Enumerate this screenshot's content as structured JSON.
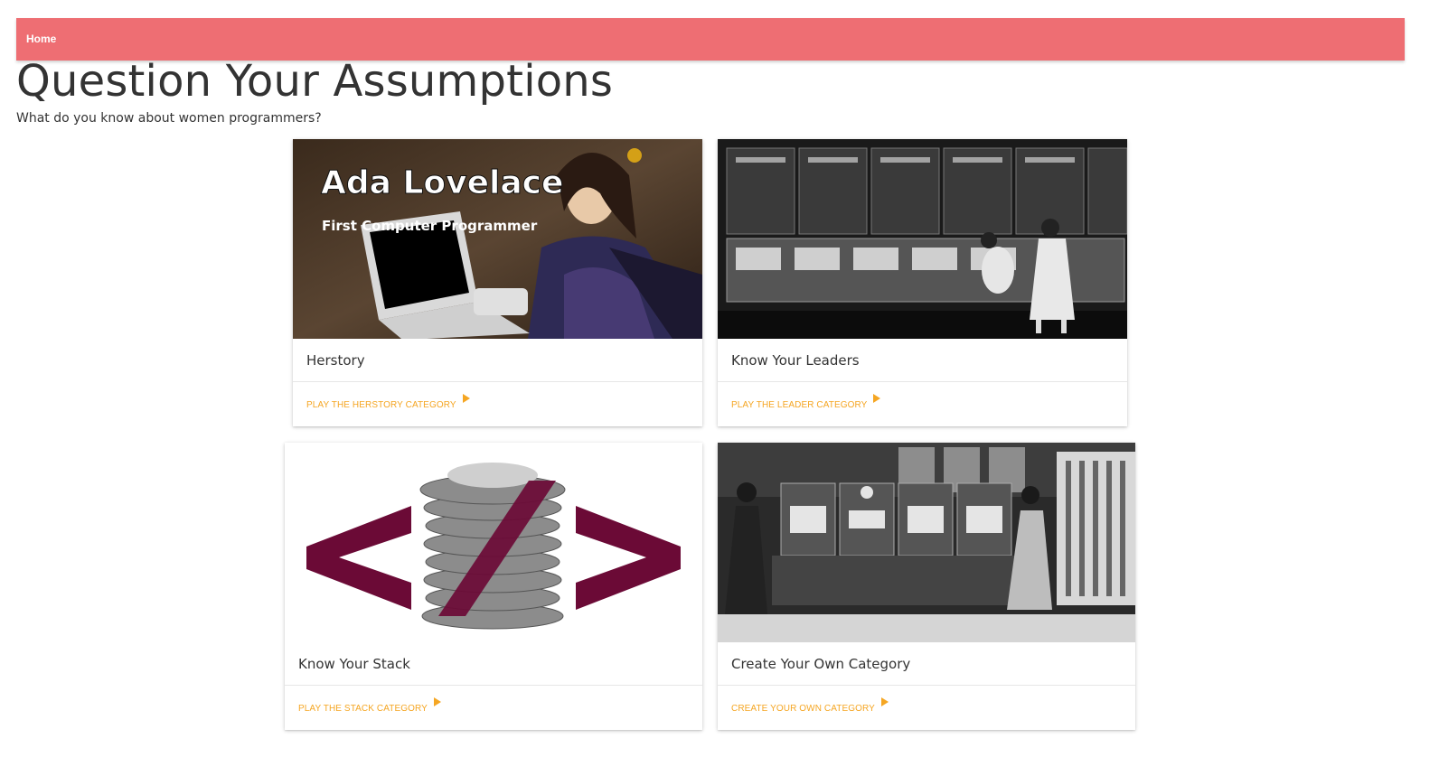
{
  "nav": {
    "home_label": "Home"
  },
  "header": {
    "title": "Question Your Assumptions",
    "subtitle": "What do you know about women programmers?"
  },
  "cards": [
    {
      "title": "Herstory",
      "action": "PLAY THE HERSTORY CATEGORY",
      "image_caption_main": "Ada Lovelace",
      "image_caption_sub": "First Computer Programmer"
    },
    {
      "title": "Know Your Leaders",
      "action": "PLAY THE LEADER CATEGORY"
    },
    {
      "title": "Know Your Stack",
      "action": "PLAY THE STACK CATEGORY"
    },
    {
      "title": "Create Your Own Category",
      "action": "CREATE YOUR OWN CATEGORY"
    }
  ],
  "colors": {
    "navbar": "#ee6e73",
    "action_link": "#f5a623",
    "stack_logo": "#6b0a36"
  }
}
